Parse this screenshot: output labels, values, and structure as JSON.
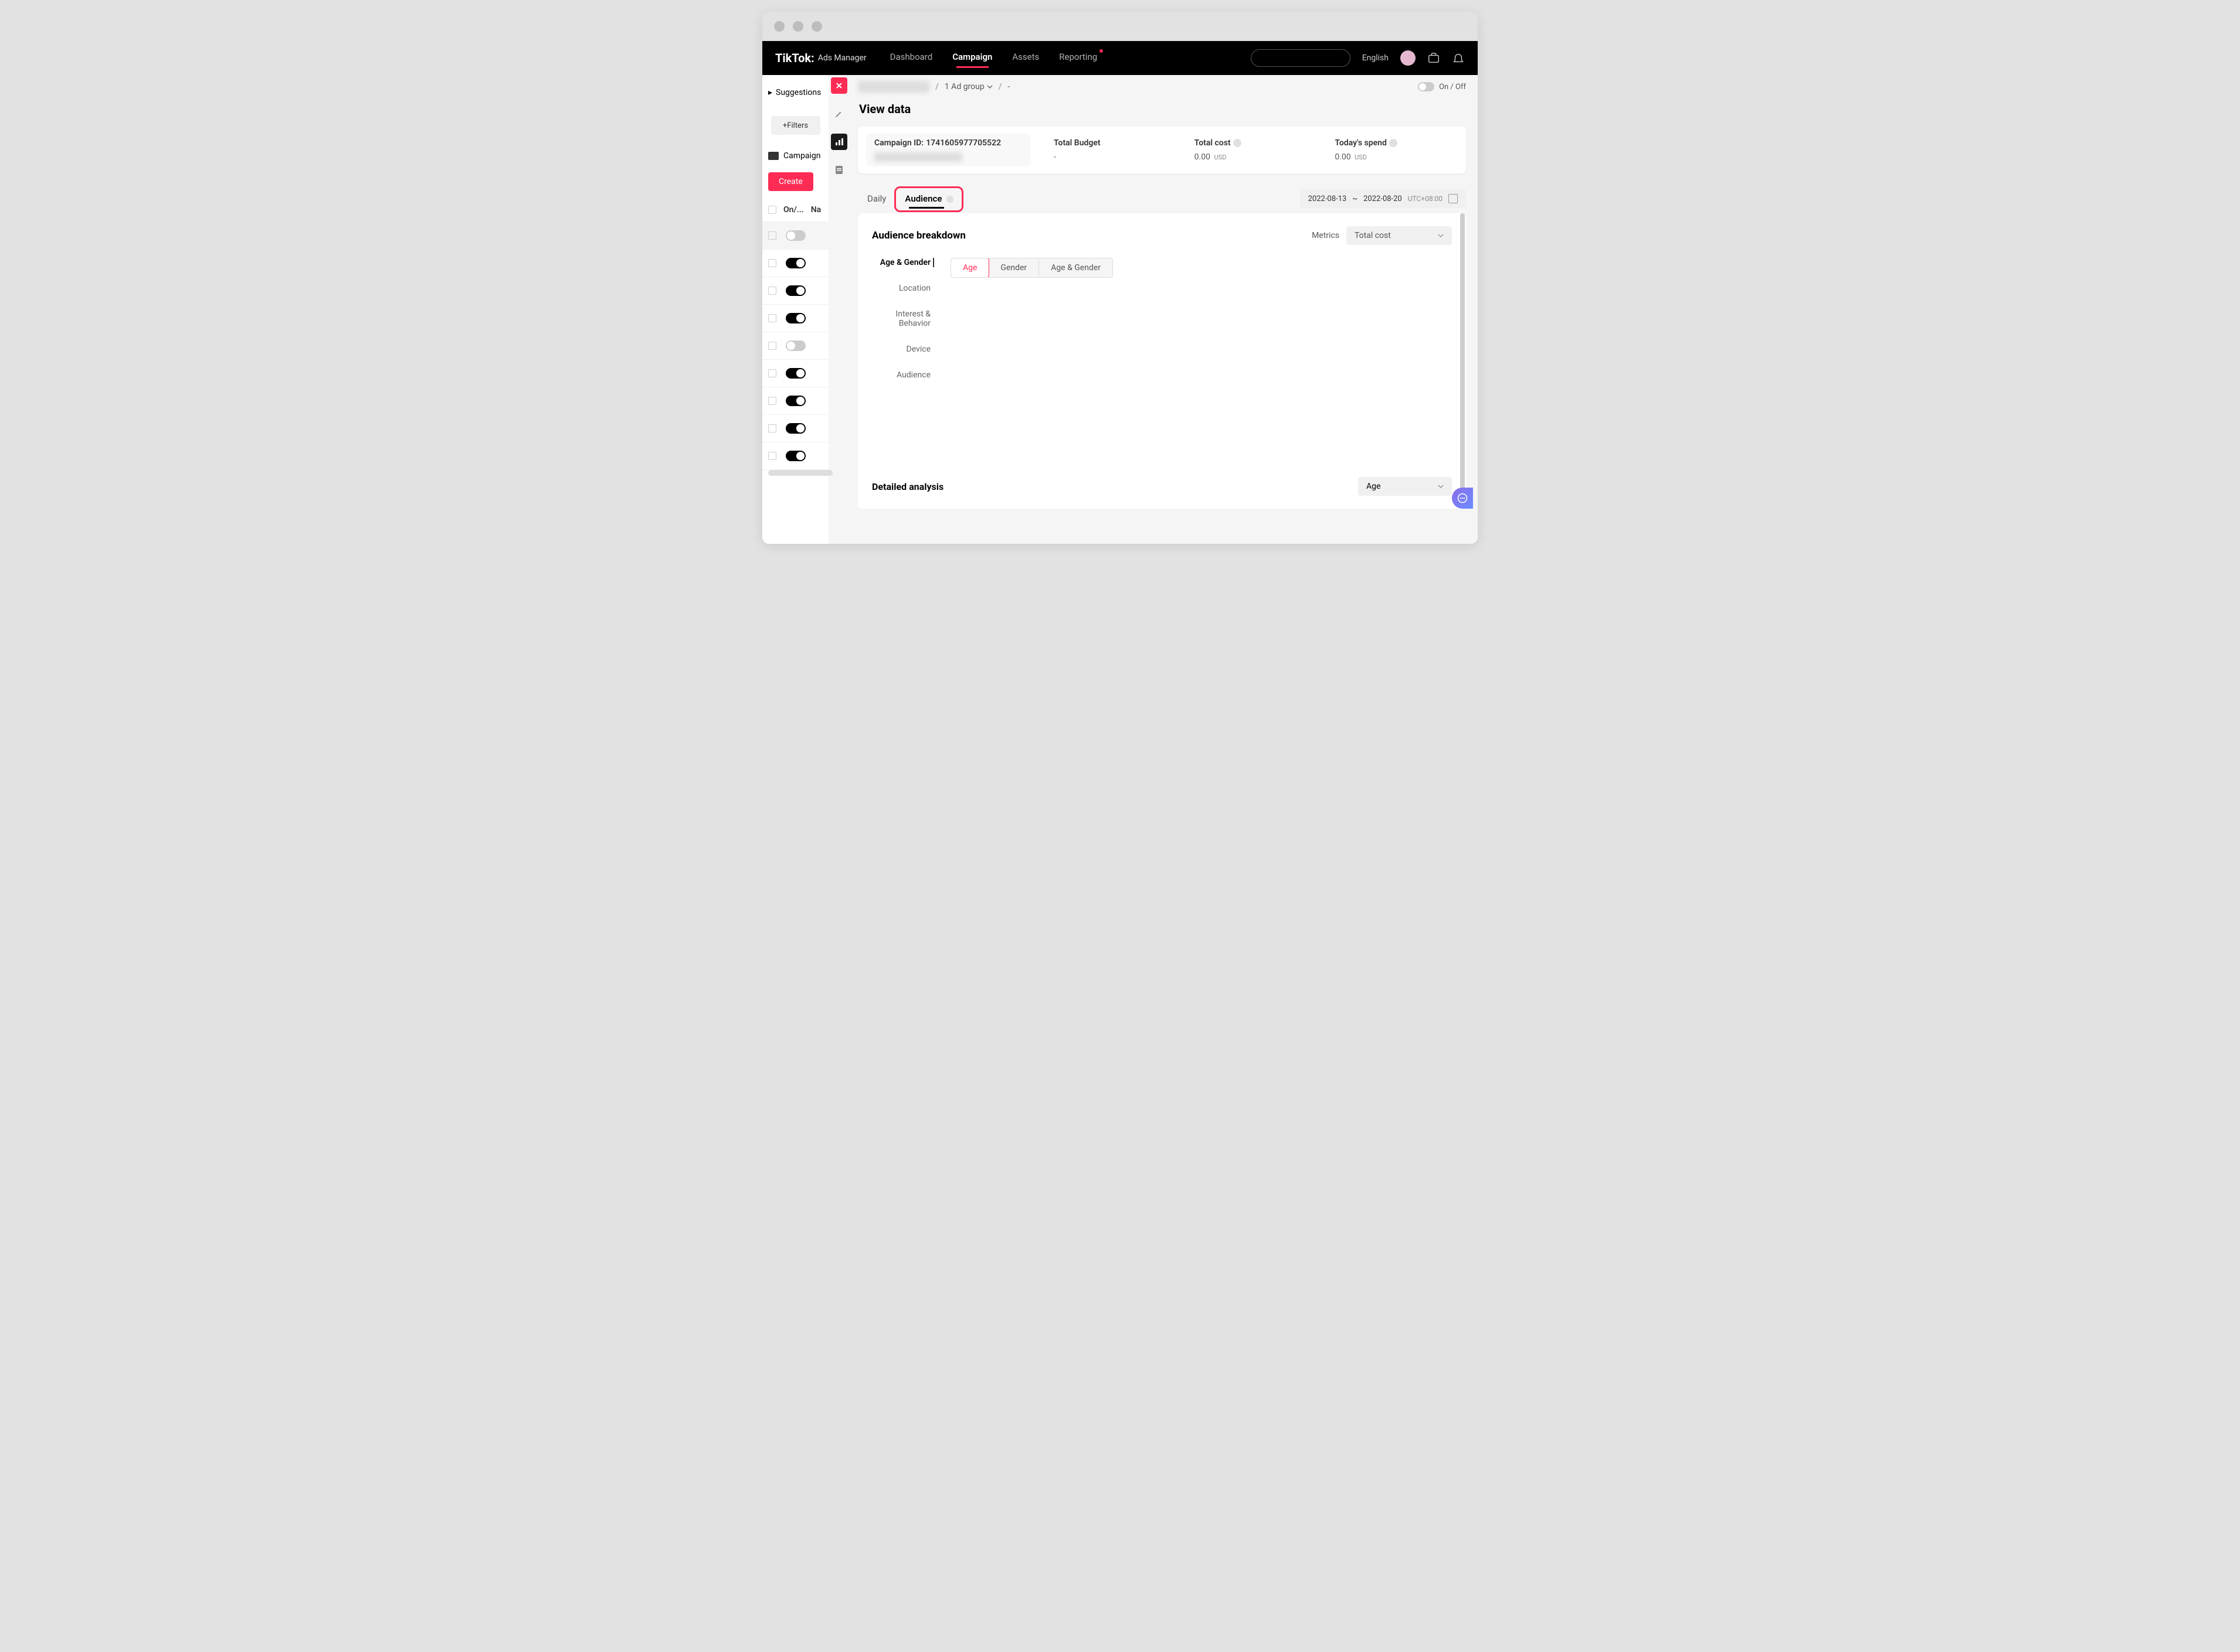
{
  "nav": {
    "logo": "TikTok:",
    "logo_sub": "Ads Manager",
    "items": [
      "Dashboard",
      "Campaign",
      "Assets",
      "Reporting"
    ],
    "active": "Campaign",
    "language": "English"
  },
  "left": {
    "suggestions": "Suggestions",
    "filters": "+Filters",
    "campaign": "Campaign",
    "create": "Create",
    "cols": {
      "onoff": "On/...",
      "name": "Na"
    },
    "rows": [
      {
        "on": false,
        "selected": true
      },
      {
        "on": true
      },
      {
        "on": true
      },
      {
        "on": true
      },
      {
        "on": false
      },
      {
        "on": true
      },
      {
        "on": true
      },
      {
        "on": true
      },
      {
        "on": true
      }
    ]
  },
  "breadcrumb": {
    "adgroup": "1 Ad group",
    "last": "-",
    "onoff_label": "On / Off"
  },
  "view_title": "View data",
  "stats": {
    "campaign_id_label": "Campaign ID:",
    "campaign_id": "1741605977705522",
    "budget_label": "Total Budget",
    "budget_val": "-",
    "cost_label": "Total cost",
    "cost_val": "0.00",
    "cost_cur": "USD",
    "spend_label": "Today's spend",
    "spend_val": "0.00",
    "spend_cur": "USD"
  },
  "tabs": {
    "daily": "Daily",
    "audience": "Audience",
    "date_from": "2022-08-13",
    "date_sep": "~",
    "date_to": "2022-08-20",
    "tz": "UTC+08:00"
  },
  "breakdown": {
    "title": "Audience breakdown",
    "metrics_label": "Metrics",
    "metrics_value": "Total cost",
    "dims": [
      "Age & Gender",
      "Location",
      "Interest & Behavior",
      "Device",
      "Audience"
    ],
    "segs": [
      "Age",
      "Gender",
      "Age & Gender"
    ]
  },
  "detailed": {
    "title": "Detailed analysis",
    "select": "Age"
  }
}
